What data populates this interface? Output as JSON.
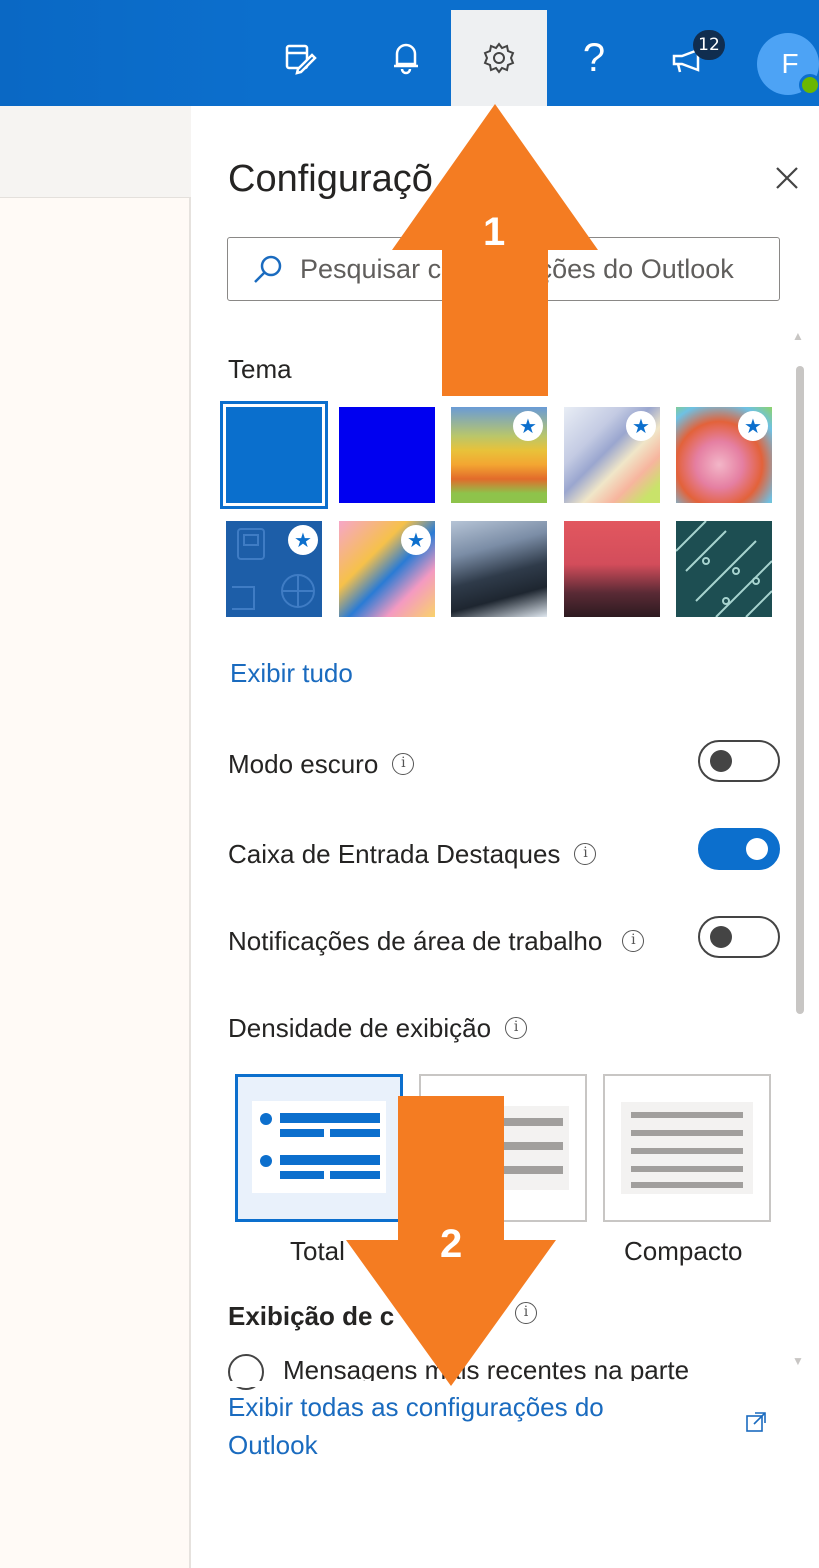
{
  "topbar": {
    "icons": [
      "calendar-edit-icon",
      "bell-icon",
      "gear-icon",
      "help-icon",
      "megaphone-icon"
    ],
    "badge_count": "12",
    "avatar_initial": "F",
    "colors": {
      "bar": "#0c6fcd",
      "active_tab": "#eef0f2"
    }
  },
  "panel": {
    "title": "Configuraçõ",
    "search_placeholder": "Pesquisar configurações do Outlook",
    "theme_section": "Tema",
    "themes": [
      {
        "name": "Azul",
        "selected": true,
        "premium": false
      },
      {
        "name": "Azul escuro",
        "selected": false,
        "premium": false
      },
      {
        "name": "Ondas",
        "selected": false,
        "premium": true
      },
      {
        "name": "Faixas",
        "selected": false,
        "premium": true
      },
      {
        "name": "Personagem",
        "selected": false,
        "premium": true
      },
      {
        "name": "Esportes",
        "selected": false,
        "premium": true
      },
      {
        "name": "Colorido",
        "selected": false,
        "premium": true
      },
      {
        "name": "Montanhas",
        "selected": false,
        "premium": false
      },
      {
        "name": "Pôr do sol",
        "selected": false,
        "premium": false
      },
      {
        "name": "Circuito",
        "selected": false,
        "premium": false
      }
    ],
    "view_all": "Exibir tudo",
    "dark_mode": {
      "label": "Modo escuro",
      "on": false
    },
    "focused_inbox": {
      "label": "Caixa de Entrada Destaques",
      "on": true
    },
    "desktop_notifications": {
      "label": "Notificações de área de trabalho",
      "on": false
    },
    "density_section": "Densidade de exibição",
    "density_options": [
      {
        "label": "Total",
        "selected": true
      },
      {
        "label": "",
        "selected": false
      },
      {
        "label": "Compacto",
        "selected": false
      }
    ],
    "conversation_section": "Exibição de c",
    "radio_label": "Mensagens mais recentes na parte",
    "footer_link": "Exibir todas as configurações do Outlook",
    "accent": "#1a6bbf"
  },
  "annotations": {
    "arrow1_number": "1",
    "arrow2_number": "2",
    "color": "#f47c22"
  }
}
